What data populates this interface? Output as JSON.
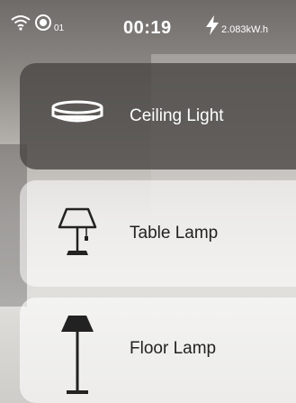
{
  "status_bar": {
    "wifi_icon": "wifi-icon",
    "target_icon": "target-icon",
    "target_count": "01",
    "time": "00:19",
    "bolt_icon": "lightning-bolt-icon",
    "energy": "2.083kW.h"
  },
  "devices": [
    {
      "label": "Ceiling Light",
      "icon": "ceiling-light-icon",
      "active": true
    },
    {
      "label": "Table Lamp",
      "icon": "table-lamp-icon",
      "active": false
    },
    {
      "label": "Floor Lamp",
      "icon": "floor-lamp-icon",
      "active": false
    }
  ],
  "colors": {
    "active_card": "#484644",
    "inactive_card": "#ffffff",
    "status_text": "#ffffff"
  }
}
